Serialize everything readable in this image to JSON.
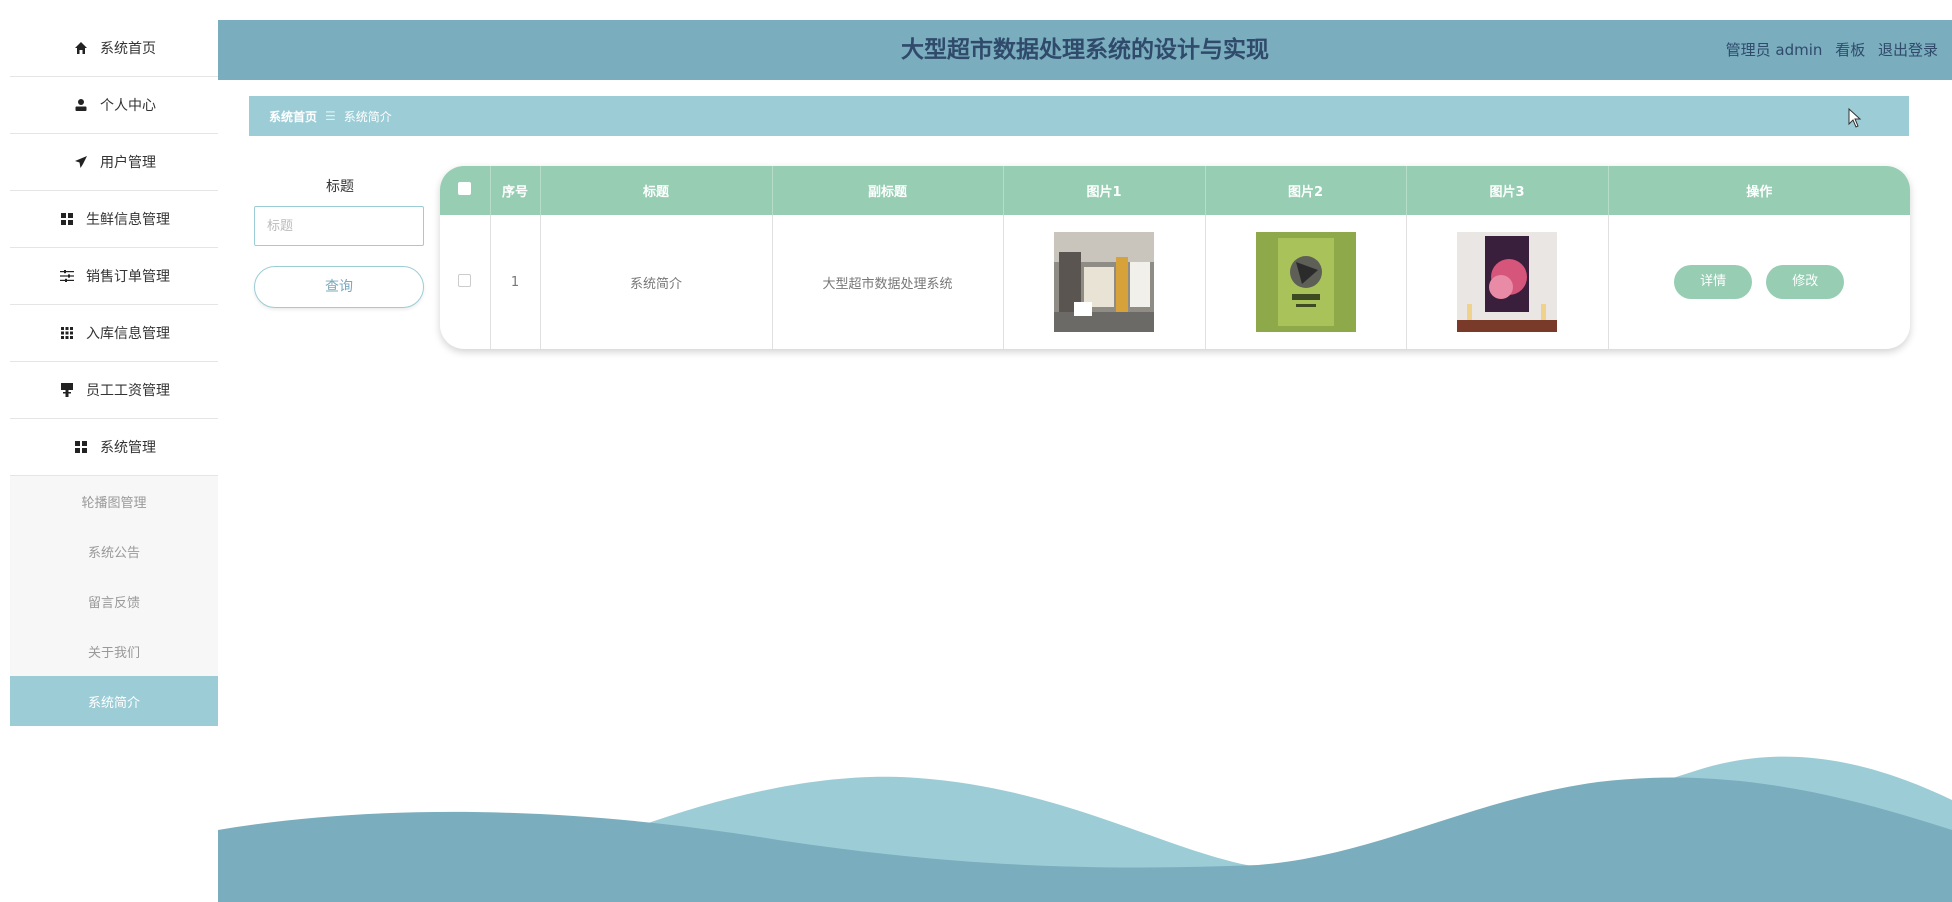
{
  "sidebar": {
    "items": [
      {
        "label": "系统首页",
        "icon": "home-icon"
      },
      {
        "label": "个人中心",
        "icon": "user-icon"
      },
      {
        "label": "用户管理",
        "icon": "send-icon"
      },
      {
        "label": "生鲜信息管理",
        "icon": "grid-icon"
      },
      {
        "label": "销售订单管理",
        "icon": "sliders-icon"
      },
      {
        "label": "入库信息管理",
        "icon": "apps-icon"
      },
      {
        "label": "员工工资管理",
        "icon": "tag-icon"
      },
      {
        "label": "系统管理",
        "icon": "grid-icon"
      }
    ],
    "subitems": [
      {
        "label": "轮播图管理"
      },
      {
        "label": "系统公告"
      },
      {
        "label": "留言反馈"
      },
      {
        "label": "关于我们"
      },
      {
        "label": "系统简介"
      }
    ]
  },
  "header": {
    "title": "大型超市数据处理系统的设计与实现",
    "user_label": "管理员 admin",
    "board_label": "看板",
    "logout_label": "退出登录"
  },
  "breadcrumb": {
    "home": "系统首页",
    "separator": "☰",
    "current": "系统简介"
  },
  "search": {
    "label": "标题",
    "placeholder": "标题",
    "button_label": "查询"
  },
  "table": {
    "headers": [
      "序号",
      "标题",
      "副标题",
      "图片1",
      "图片2",
      "图片3",
      "操作"
    ],
    "rows": [
      {
        "index": "1",
        "title": "系统简介",
        "subtitle": "大型超市数据处理系统",
        "detail_label": "详情",
        "edit_label": "修改"
      }
    ]
  },
  "colors": {
    "topbar": "#7aadbd",
    "accent": "#9ccdd6",
    "table_header": "#96cdb3",
    "title_text": "#2f4a6b"
  }
}
